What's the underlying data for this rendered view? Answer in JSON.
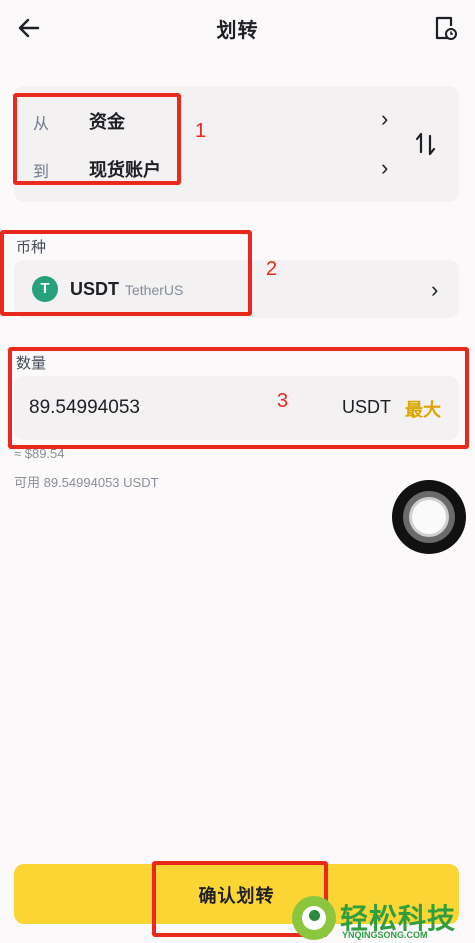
{
  "header": {
    "title": "划转",
    "back_icon": "arrow-left-icon",
    "history_icon": "transfer-history-icon"
  },
  "transfer": {
    "from_label": "从",
    "from_value": "资金",
    "to_label": "到",
    "to_value": "现货账户",
    "swap_icon": "swap-arrows-icon"
  },
  "coin": {
    "section_label": "币种",
    "symbol": "USDT",
    "name": "TetherUS",
    "logo_glyph": "T",
    "logo_color": "#26a17b"
  },
  "amount": {
    "section_label": "数量",
    "value": "89.54994053",
    "unit": "USDT",
    "max_label": "最大",
    "usd_approx": "≈ $89.54",
    "available": "可用 89.54994053 USDT"
  },
  "confirm": {
    "label": "确认划转"
  },
  "annotations": {
    "labels": [
      "1",
      "2",
      "3"
    ],
    "color": "#e8291c"
  },
  "watermark": {
    "text": "轻松科技",
    "url": "YNQINGSONG.COM"
  },
  "colors": {
    "accent_yellow": "#fad533",
    "max_text": "#d9a800",
    "card_bg": "#f3f1f2",
    "page_bg": "#fbf9fa"
  }
}
